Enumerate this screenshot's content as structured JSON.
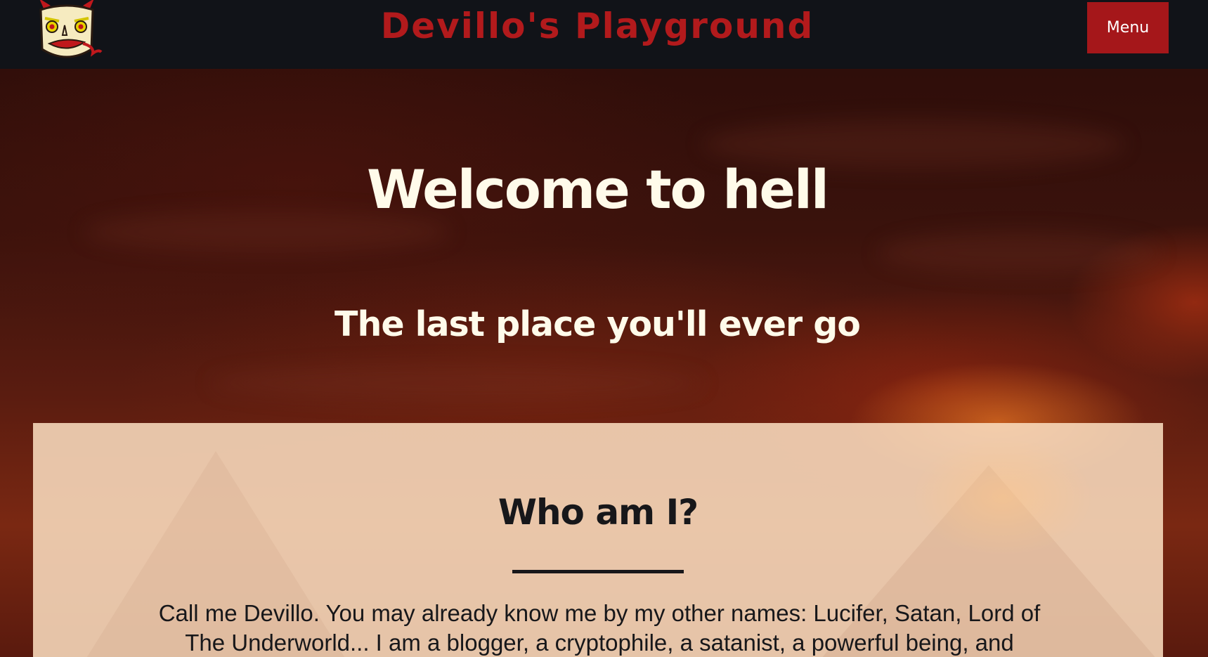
{
  "header": {
    "site_title": "Devillo's Playground",
    "menu_label": "Menu"
  },
  "hero": {
    "title": "Welcome to hell",
    "subtitle": "The last place you'll ever go"
  },
  "about": {
    "heading": "Who am I?",
    "text": "Call me Devillo. You may already know me by my other names: Lucifer, Satan, Lord of The Underworld... I am a blogger, a cryptophile, a satanist, a powerful being, and"
  },
  "colors": {
    "header_bg": "#111318",
    "brand_red": "#b21a1c",
    "menu_bg": "#a5171a",
    "hero_text": "#fffbea",
    "panel_bg": "#fadec0",
    "panel_text": "#17171a"
  },
  "icons": {
    "logo": "devil-face-icon"
  }
}
